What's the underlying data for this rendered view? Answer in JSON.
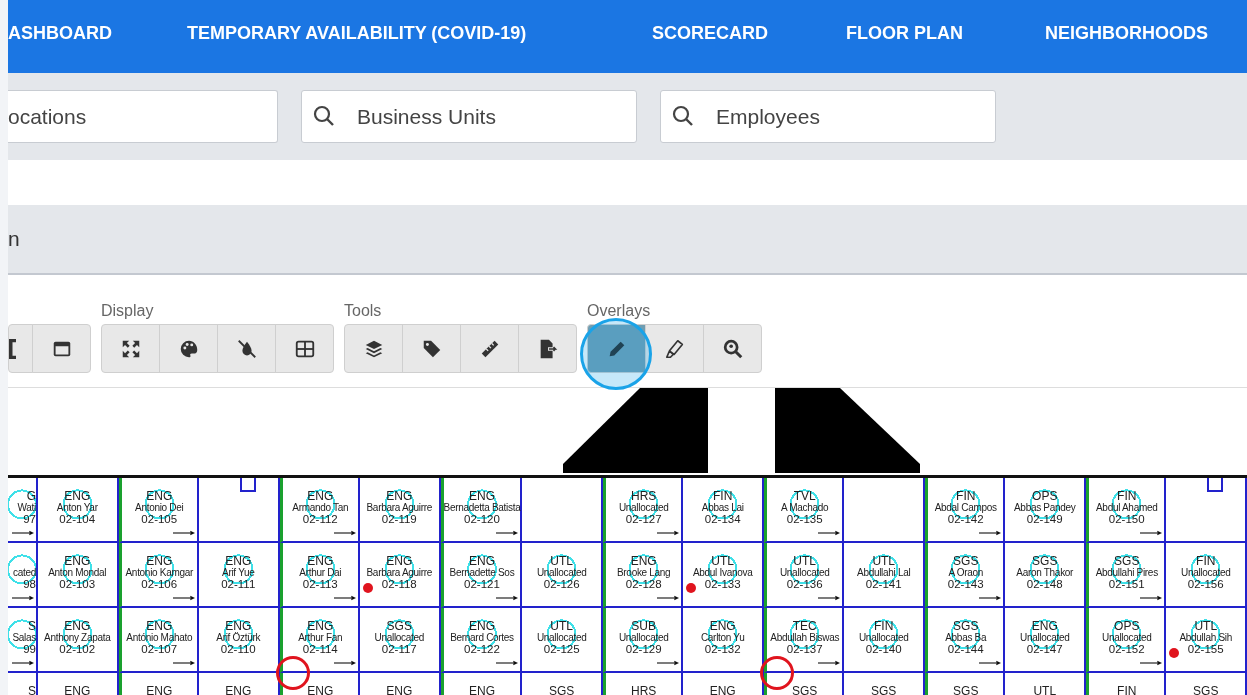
{
  "nav": [
    "ASHBOARD",
    "TEMPORARY AVAILABILITY (COVID-19)",
    "SCORECARD",
    "FLOOR PLAN",
    "NEIGHBORHOODS"
  ],
  "search_fields": [
    {
      "placeholder": "ocations",
      "icon": false
    },
    {
      "placeholder": "Business Units",
      "icon": true
    },
    {
      "placeholder": "Employees",
      "icon": true
    }
  ],
  "page_title": "n",
  "toolbar_groups": [
    {
      "buttons": [
        {
          "selected": false
        },
        {
          "selected": false
        }
      ]
    },
    {
      "label": "Display",
      "buttons": [
        {
          "selected": false
        },
        {
          "selected": false
        },
        {
          "selected": false
        },
        {
          "selected": false
        }
      ]
    },
    {
      "label": "Tools",
      "buttons": [
        {
          "selected": false
        },
        {
          "selected": false
        },
        {
          "selected": false
        },
        {
          "selected": false
        }
      ]
    },
    {
      "label": "Overlays",
      "buttons": [
        {
          "selected": true
        },
        {
          "selected": false
        },
        {
          "selected": false
        }
      ]
    }
  ],
  "floor_plan": {
    "rows": [
      [
        {
          "kind": "desk",
          "department": "G",
          "occupant": "Wati",
          "desk": "97",
          "linked": true
        },
        {
          "kind": "desk",
          "department": "ENG",
          "occupant": "Anton Yar",
          "desk": "02-104"
        },
        {
          "kind": "desk",
          "department": "ENG",
          "occupant": "Antonio Dei",
          "desk": "02-105",
          "linked": true
        },
        {
          "kind": "fixture"
        },
        {
          "kind": "desk",
          "department": "ENG",
          "occupant": "Armando Tan",
          "desk": "02-112",
          "linked": true
        },
        {
          "kind": "desk",
          "department": "ENG",
          "occupant": "Barbara Aguirre",
          "desk": "02-119"
        },
        {
          "kind": "desk",
          "department": "ENG",
          "occupant": "Bernadetta Batista",
          "desk": "02-120",
          "linked": true
        },
        {
          "kind": "empty"
        },
        {
          "kind": "desk",
          "department": "HRS",
          "occupant": "Unallocated",
          "desk": "02-127",
          "linked": true
        },
        {
          "kind": "desk",
          "department": "FIN",
          "occupant": "Abbas Lai",
          "desk": "02-134"
        },
        {
          "kind": "desk",
          "department": "TVL",
          "occupant": "A Machado",
          "desk": "02-135",
          "linked": true
        },
        {
          "kind": "empty"
        },
        {
          "kind": "desk",
          "department": "FIN",
          "occupant": "Abdal Campos",
          "desk": "02-142",
          "linked": true
        },
        {
          "kind": "desk",
          "department": "OPS",
          "occupant": "Abbas Pandey",
          "desk": "02-149"
        },
        {
          "kind": "desk",
          "department": "FIN",
          "occupant": "Abdul Ahamed",
          "desk": "02-150",
          "linked": true
        },
        {
          "kind": "fixture"
        }
      ],
      [
        {
          "kind": "desk",
          "occupant": "cated",
          "desk": "98",
          "linked": true
        },
        {
          "kind": "desk",
          "department": "ENG",
          "occupant": "Anton Mondal",
          "desk": "02-103"
        },
        {
          "kind": "desk",
          "department": "ENG",
          "occupant": "Antonio Kamgar",
          "desk": "02-106",
          "linked": true
        },
        {
          "kind": "desk",
          "department": "ENG",
          "occupant": "Arif Yue",
          "desk": "02-111"
        },
        {
          "kind": "desk",
          "department": "ENG",
          "occupant": "Arthur Dai",
          "desk": "02-113",
          "linked": true
        },
        {
          "kind": "desk",
          "department": "ENG",
          "occupant": "Barbara Aguirre",
          "desk": "02-118",
          "alert_dot": true
        },
        {
          "kind": "desk",
          "department": "ENG",
          "occupant": "Bernadette Sos",
          "desk": "02-121",
          "linked": true
        },
        {
          "kind": "desk",
          "department": "UTL",
          "occupant": "Unallocated",
          "desk": "02-126"
        },
        {
          "kind": "desk",
          "department": "ENG",
          "occupant": "Brooke Lang",
          "desk": "02-128",
          "linked": true
        },
        {
          "kind": "desk",
          "department": "UTL",
          "occupant": "Abdul Ivanova",
          "desk": "02-133",
          "alert_dot": true
        },
        {
          "kind": "desk",
          "department": "UTL",
          "occupant": "Unallocated",
          "desk": "02-136",
          "linked": true
        },
        {
          "kind": "desk",
          "department": "UTL",
          "occupant": "Abdullahi Lal",
          "desk": "02-141"
        },
        {
          "kind": "desk",
          "department": "SGS",
          "occupant": "A Oraon",
          "desk": "02-143",
          "linked": true
        },
        {
          "kind": "desk",
          "department": "SGS",
          "occupant": "Aaron Thakor",
          "desk": "02-148"
        },
        {
          "kind": "desk",
          "department": "SGS",
          "occupant": "Abdullahi Pires",
          "desk": "02-151",
          "linked": true
        },
        {
          "kind": "desk",
          "department": "FIN",
          "occupant": "Unallocated",
          "desk": "02-156"
        }
      ],
      [
        {
          "kind": "desk",
          "department": "S",
          "occupant": "Salas",
          "desk": "99",
          "linked": true
        },
        {
          "kind": "desk",
          "department": "ENG",
          "occupant": "Anthony Zapata",
          "desk": "02-102"
        },
        {
          "kind": "desk",
          "department": "ENG",
          "occupant": "António Mahato",
          "desk": "02-107",
          "linked": true
        },
        {
          "kind": "desk",
          "department": "ENG",
          "occupant": "Arif Öztürk",
          "desk": "02-110"
        },
        {
          "kind": "desk",
          "department": "ENG",
          "occupant": "Arthur Fan",
          "desk": "02-114",
          "linked": true,
          "alert_ring": true
        },
        {
          "kind": "desk",
          "department": "SGS",
          "occupant": "Unallocated",
          "desk": "02-117"
        },
        {
          "kind": "desk",
          "department": "ENG",
          "occupant": "Bernard Cortes",
          "desk": "02-122",
          "linked": true
        },
        {
          "kind": "desk",
          "department": "UTL",
          "occupant": "Unallocated",
          "desk": "02-125"
        },
        {
          "kind": "desk",
          "department": "SUB",
          "occupant": "Unallocated",
          "desk": "02-129",
          "linked": true
        },
        {
          "kind": "desk",
          "department": "ENG",
          "occupant": "Carlton Yu",
          "desk": "02-132"
        },
        {
          "kind": "desk",
          "department": "TEC",
          "occupant": "Abdullah Biswas",
          "desk": "02-137",
          "linked": true,
          "alert_ring": true
        },
        {
          "kind": "desk",
          "department": "FIN",
          "occupant": "Unallocated",
          "desk": "02-140"
        },
        {
          "kind": "desk",
          "department": "SGS",
          "occupant": "Abbas Ba",
          "desk": "02-144",
          "linked": true
        },
        {
          "kind": "desk",
          "department": "ENG",
          "occupant": "Unallocated",
          "desk": "02-147"
        },
        {
          "kind": "desk",
          "department": "OPS",
          "occupant": "Unallocated",
          "desk": "02-152",
          "linked": true
        },
        {
          "kind": "desk",
          "department": "UTL",
          "occupant": "Abdullah Sih",
          "desk": "02-155",
          "alert_dot": true
        }
      ],
      [
        {
          "kind": "desk",
          "department": "S"
        },
        {
          "kind": "desk",
          "department": "ENG"
        },
        {
          "kind": "desk",
          "department": "ENG"
        },
        {
          "kind": "desk",
          "department": "ENG"
        },
        {
          "kind": "desk",
          "department": "ENG"
        },
        {
          "kind": "desk",
          "department": "ENG"
        },
        {
          "kind": "desk",
          "department": "ENG"
        },
        {
          "kind": "desk",
          "department": "SGS"
        },
        {
          "kind": "desk",
          "department": "HRS"
        },
        {
          "kind": "desk",
          "department": "ENG"
        },
        {
          "kind": "desk",
          "department": "SGS"
        },
        {
          "kind": "desk",
          "department": "SGS"
        },
        {
          "kind": "desk",
          "department": "SGS"
        },
        {
          "kind": "desk",
          "department": "UTL"
        },
        {
          "kind": "desk",
          "department": "FIN"
        },
        {
          "kind": "desk",
          "department": "SGS"
        }
      ]
    ]
  }
}
